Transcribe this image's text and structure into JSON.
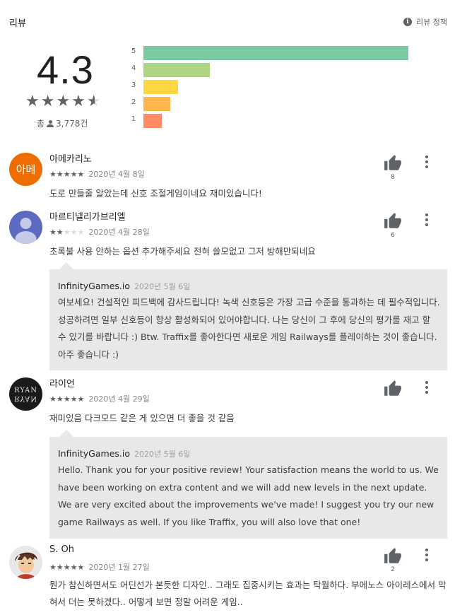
{
  "header": {
    "title": "리뷰",
    "policy_label": "리뷰 정책",
    "info_icon": "i"
  },
  "summary": {
    "rating": "4.3",
    "stars": "★★★★",
    "half_star": "★",
    "total_prefix": "총",
    "total_count": "3,778건",
    "distribution": [
      {
        "label": "5",
        "fraction": 1.0,
        "color": "#7bcaa1"
      },
      {
        "label": "4",
        "fraction": 0.25,
        "color": "#aed581"
      },
      {
        "label": "3",
        "fraction": 0.13,
        "color": "#ffd740"
      },
      {
        "label": "2",
        "fraction": 0.1,
        "color": "#ffb74d"
      },
      {
        "label": "1",
        "fraction": 0.07,
        "color": "#ff8a65"
      }
    ]
  },
  "reviews": [
    {
      "name": "아메카리노",
      "avatar_text": "아메",
      "avatar_color": "#ef6c00",
      "rating": 5,
      "date": "2020년 4월 8일",
      "text": "도로 만들줄 알았는데 신호 조절게임이네요 재미있습니다!",
      "helpful": "8"
    },
    {
      "name": "마르티넬리가브리엘",
      "avatar_color": "#5c6bc0",
      "rating": 2,
      "date": "2020년 4월 28일",
      "text": "초록불 사용 안하는 옵션 추가해주세요 전혀 쓸모없고 그저 방해만되네요",
      "helpful": "6",
      "reply": {
        "author": "InfinityGames.io",
        "date": "2020년 5월 6일",
        "text": "여보세요! 건설적인 피드백에 감사드립니다! 녹색 신호등은 가장 고급 수준을 통과하는 데 필수적입니다. 성공하려면 일부 신호등이 항상 활성화되어 있어야합니다. 나는 당신이 그 후에 당신의 평가를 재고 할 수 있기를 바랍니다 :) Btw. Traffix를 좋아한다면 새로운 게임 Railways를 플레이하는 것이 좋습니다. 아주 좋습니다 :)"
      }
    },
    {
      "name": "라이언",
      "avatar_text": "RYAN",
      "avatar_color": "#1a1a1a",
      "rating": 5,
      "date": "2020년 4월 29일",
      "text": "재미있음 다크모드 같은 게 있으면 더 좋을 것 같음",
      "helpful": "",
      "reply": {
        "author": "InfinityGames.io",
        "date": "2020년 5월 6일",
        "text": "Hello. Thank you for your positive review! Your satisfaction means the world to us. We have been working on extra content and we will add new levels in the next update. We are very excited about the improvements we've made! I suggest you try our new game Railways as well. If you like Traffix, you will also love that one!"
      }
    },
    {
      "name": "S. Oh",
      "avatar_color": "#d9d9d9",
      "rating": 5,
      "date": "2020년 1월 27일",
      "text": "뭔가 참신하면서도 어딘선가 본듯한 디자인.. 그래도 집중시키는 효과는 탁월하다. 부에노스 아이레스에서 막혀서 더는 못하겠다.. 어떻게 보면 정말 어려운 게임..",
      "helpful": "2"
    }
  ]
}
